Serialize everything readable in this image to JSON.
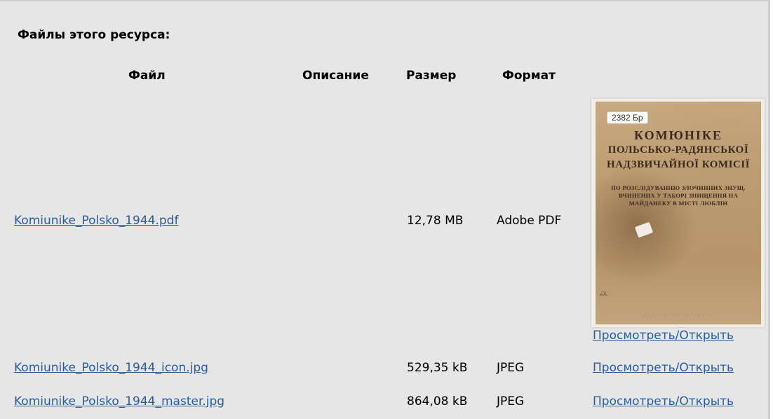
{
  "heading": "Файлы этого ресурса:",
  "columns": {
    "file": "Файл",
    "description": "Описание",
    "size": "Размер",
    "format": "Формат"
  },
  "rows": [
    {
      "file_name": "Komiunike_Polsko_1944.pdf",
      "description": "",
      "size": "12,78 MB",
      "format": "Adobe PDF",
      "view_label": "Просмотреть/Открыть",
      "thumbnail": {
        "badge": "2382 Бр",
        "title_line1": "КОМЮНІКЕ",
        "title_line2": "ПОЛЬСЬКО-РАДЯНСЬКОЇ",
        "title_line3": "НАДЗВИЧАЙНОЇ КОМІСІЇ",
        "subtitle": "ПО РОЗСЛІДУВАННЮ ЗЛОЧИННИХ ЗНУЩ. ВЧИНЕНИХ У ТАБОРІ ЗНИЩЕННЯ НА МАЙДАНЕКУ В МІСТІ ЛЮБЛІН"
      }
    },
    {
      "file_name": "Komiunike_Polsko_1944_icon.jpg",
      "description": "",
      "size": "529,35 kB",
      "format": "JPEG",
      "view_label": "Просмотреть/Открыть"
    },
    {
      "file_name": "Komiunike_Polsko_1944_master.jpg",
      "description": "",
      "size": "864,08 kB",
      "format": "JPEG",
      "view_label": "Просмотреть/Открыть"
    }
  ]
}
